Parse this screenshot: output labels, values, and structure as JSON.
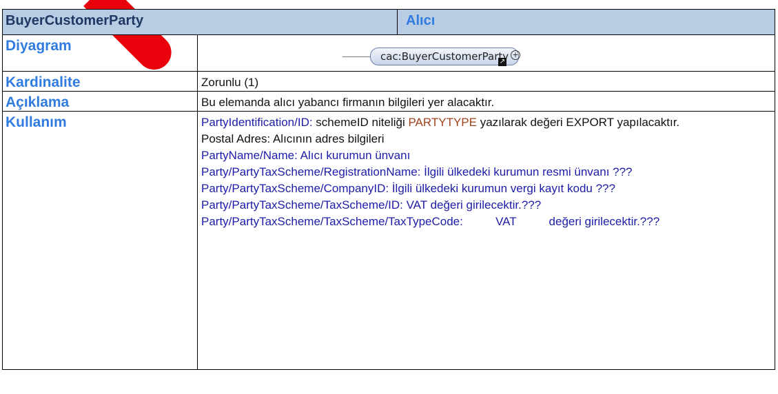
{
  "header": {
    "element_name": "BuyerCustomerParty",
    "turkish_name": "Alıcı"
  },
  "rows": {
    "diagram": {
      "label": "Diyagram",
      "node_label": "cac:BuyerCustomerParty"
    },
    "cardinality": {
      "label": "Kardinalite",
      "value": "Zorunlu (1)"
    },
    "description": {
      "label": "Açıklama",
      "value": "Bu elemanda alıcı yabancı firmanın bilgileri yer alacaktır."
    },
    "usage": {
      "label": "Kullanım",
      "line1_path": "PartyIdentification/ID:",
      "line1_text_a": " schemeID niteliği ",
      "line1_highlight": "PARTYTYPE",
      "line1_text_b": " yazılarak değeri EXPORT yapılacaktır.",
      "line2": "Postal Adres:  Alıcının adres bilgileri",
      "line3": "PartyName/Name: Alıcı kurumun ünvanı",
      "line4_path": "Party/PartyTaxScheme/RegistrationName:",
      "line4_text": " İlgili ülkedeki kurumun resmi ünvanı ???",
      "line5_path": "Party/PartyTaxScheme/CompanyID:",
      "line5_text": " İlgili ülkedeki kurumun vergi kayıt kodu ???",
      "line6": "Party/PartyTaxScheme/TaxScheme/ID: VAT değeri girilecektir.???",
      "line7": "Party/PartyTaxScheme/TaxScheme/TaxTypeCode:          VAT          değeri girilecektir.???"
    }
  },
  "colors": {
    "header_bg": "#b8cce4",
    "label_blue": "#2f7be0",
    "usage_blue": "#1c1ca8",
    "highlight_brown": "#a0411c",
    "annotation_red": "#e8000b"
  }
}
